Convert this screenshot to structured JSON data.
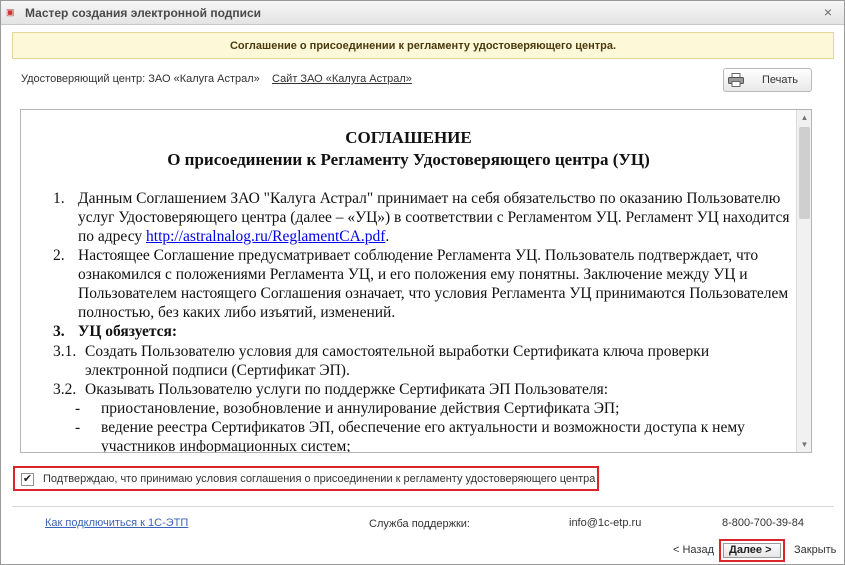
{
  "window": {
    "title": "Мастер создания электронной подписи",
    "close_glyph": "×"
  },
  "banner": {
    "text": "Соглашение о присоединении к регламенту удостоверяющего центра."
  },
  "ca": {
    "label": "Удостоверяющий центр: ЗАО «Калуга Астрал»",
    "site_link": "Сайт ЗАО «Калуга Астрал»"
  },
  "print_button": {
    "label": "Печать",
    "icon": "printer-icon"
  },
  "document": {
    "title": "СОГЛАШЕНИЕ",
    "subtitle": "О присоединении к Регламенту Удостоверяющего центра (УЦ)",
    "p1_num": "1.",
    "p1_text": "Данным Соглашением ЗАО \"Калуга Астрал\" принимает на себя обязательство по оказанию Пользователю услуг Удостоверяющего центра (далее – «УЦ») в соответствии с Регламентом УЦ. Регламент УЦ находится по адресу ",
    "p1_link": "http://astralnalog.ru/ReglamentCA.pdf",
    "p1_end": ".",
    "p2_num": "2.",
    "p2_text": "Настоящее Соглашение предусматривает соблюдение Регламента УЦ. Пользователь подтверждает, что ознакомился с положениями Регламента УЦ, и его положения ему понятны. Заключение между УЦ и Пользователем настоящего Соглашения означает, что условия Регламента УЦ принимаются Пользователем полностью, без каких либо изъятий, изменений.",
    "p3_num": "3.",
    "p3_text": "УЦ обязуется:",
    "p31_num": "3.1.",
    "p31_text": "Создать Пользователю условия для самостоятельной выработки Сертификата ключа проверки электронной подписи (Сертификат ЭП).",
    "p32_num": "3.2.",
    "p32_text": "Оказывать Пользователю услуги по поддержке Сертификата ЭП Пользователя:",
    "b1_dash": "-",
    "b1_text": "приостановление, возобновление и аннулирование действия Сертификата ЭП;",
    "b2_dash": "-",
    "b2_text": "ведение реестра Сертификатов ЭП, обеспечение его актуальности и возможности доступа к нему участников информационных систем;"
  },
  "confirm": {
    "checked": true,
    "check_glyph": "✔",
    "label": "Подтверждаю, что принимаю условия соглашения о присоединении к регламенту удостоверяющего центра"
  },
  "footer": {
    "howto_link": "Как подключиться к 1С-ЭТП",
    "support_label": "Служба поддержки:",
    "email": "info@1c-etp.ru",
    "phone": "8-800-700-39-84"
  },
  "nav": {
    "back": "< Назад",
    "next": "Далее  >",
    "close": "Закрыть"
  },
  "colors": {
    "highlight_border": "#d9262b",
    "banner_bg": "#fdf8d7",
    "link": "#3b63b5"
  }
}
